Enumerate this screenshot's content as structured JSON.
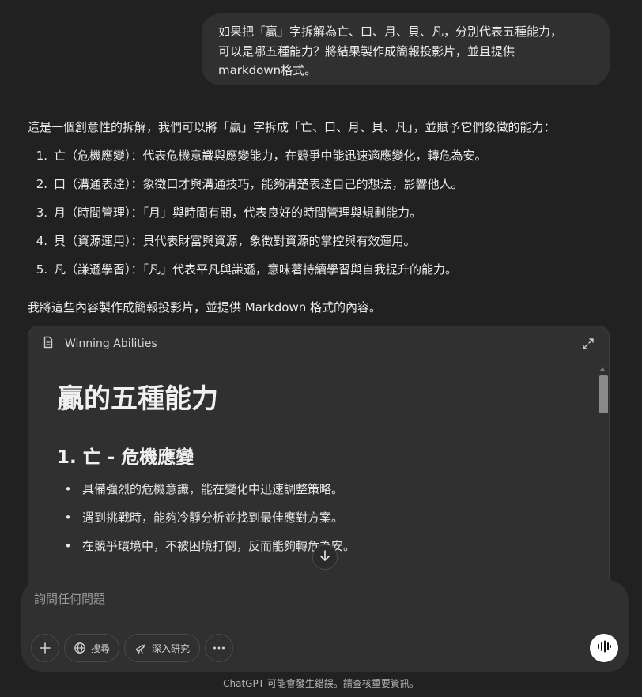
{
  "user_message": {
    "line1": "如果把「贏」字拆解為亡、口、月、貝、凡，分別代表五種能力，",
    "line2": "可以是哪五種能力？將結果製作成簡報投影片，並且提供",
    "line3": "markdown格式。"
  },
  "assistant": {
    "intro": "這是一個創意性的拆解，我們可以將「贏」字拆成「亡、口、月、貝、凡」，並賦予它們象徵的能力：",
    "items": [
      {
        "num": "1.",
        "text": "亡（危機應變）：代表危機意識與應變能力，在競爭中能迅速適應變化，轉危為安。"
      },
      {
        "num": "2.",
        "text": "口（溝通表達）：象徵口才與溝通技巧，能夠清楚表達自己的想法，影響他人。"
      },
      {
        "num": "3.",
        "text": "月（時間管理）：「月」與時間有關，代表良好的時間管理與規劃能力。"
      },
      {
        "num": "4.",
        "text": "貝（資源運用）：貝代表財富與資源，象徵對資源的掌控與有效運用。"
      },
      {
        "num": "5.",
        "text": "凡（謙遜學習）：「凡」代表平凡與謙遜，意味著持續學習與自我提升的能力。"
      }
    ],
    "outro": "我將這些內容製作成簡報投影片，並提供 Markdown 格式的內容。"
  },
  "canvas": {
    "title": "Winning Abilities",
    "doc_h1": "贏的五種能力",
    "doc_h2": "1. 亡 - 危機應變",
    "bullets": [
      "具備強烈的危機意識，能在變化中迅速調整策略。",
      "遇到挑戰時，能夠冷靜分析並找到最佳應對方案。",
      "在競爭環境中，不被困境打倒，反而能夠轉危為安。"
    ],
    "bullet_glyph": "•"
  },
  "composer": {
    "placeholder": "詢問任何問題",
    "search_label": "搜尋",
    "research_label": "深入研究"
  },
  "footer": "ChatGPT 可能會發生錯誤。請查核重要資訊。",
  "colors": {
    "background": "#212121",
    "bubble": "#303030",
    "text": "#ececec"
  },
  "icons": [
    "document-icon",
    "expand-icon",
    "arrow-down-icon",
    "plus-icon",
    "globe-icon",
    "telescope-icon",
    "more-icon",
    "voice-icon"
  ]
}
